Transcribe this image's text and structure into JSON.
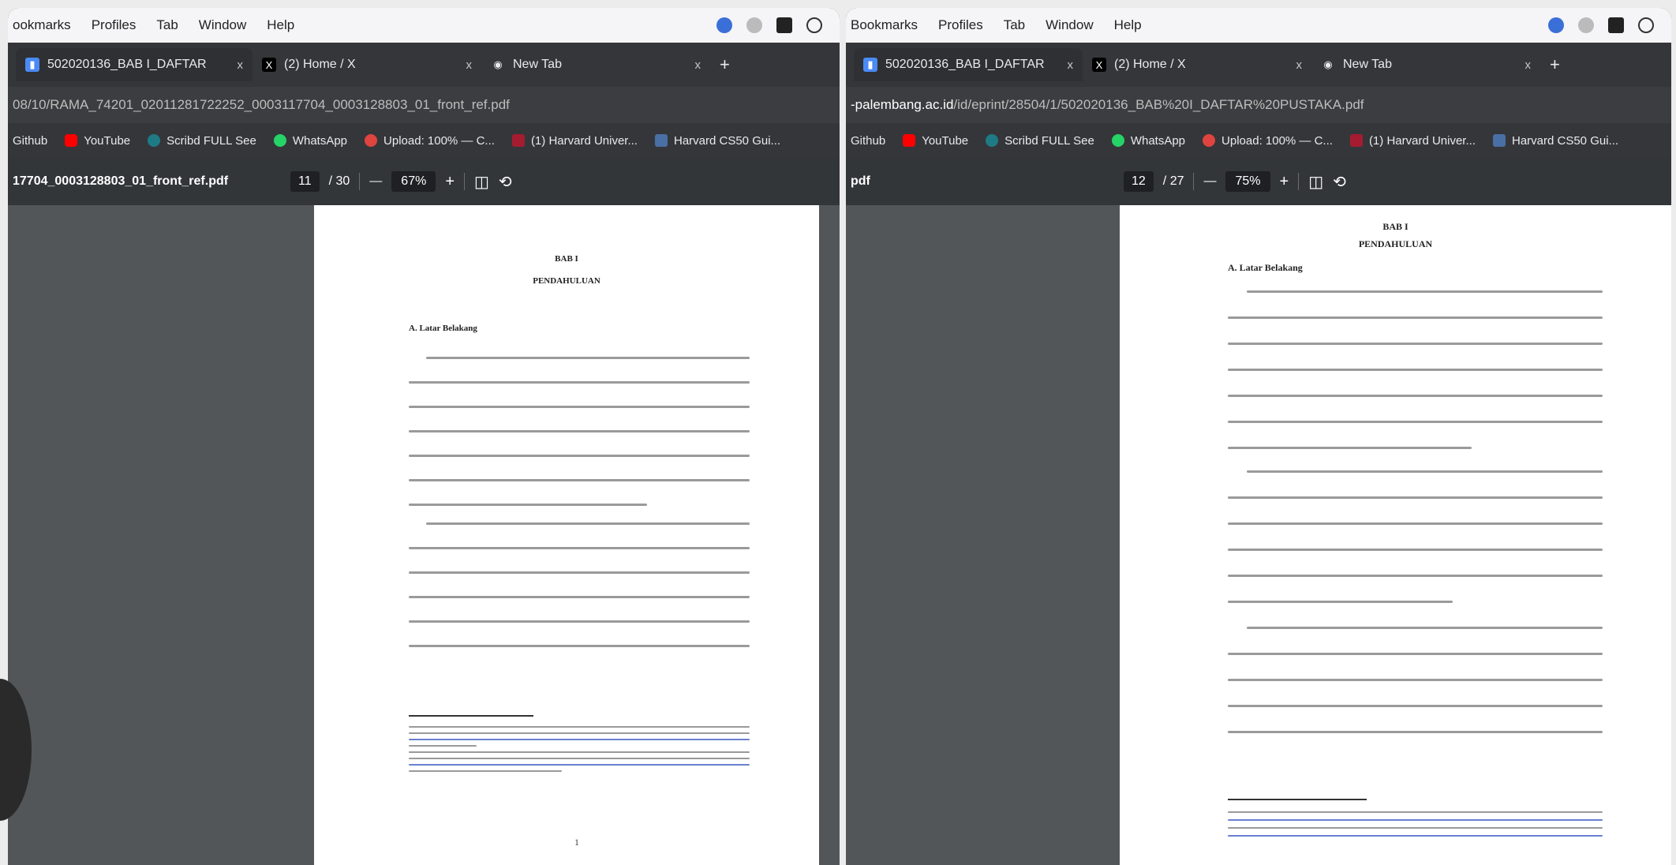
{
  "menu": {
    "items": [
      "Bookmarks",
      "Profiles",
      "Tab",
      "Window",
      "Help"
    ],
    "left_first": "ookmarks"
  },
  "tabs": [
    {
      "label": "502020136_BAB I_DAFTAR"
    },
    {
      "label": "(2) Home / X"
    },
    {
      "label": "New Tab"
    }
  ],
  "left": {
    "url": "08/10/RAMA_74201_02011281722252_0003117704_0003128803_01_front_ref.pdf",
    "pdf_filename": "17704_0003128803_01_front_ref.pdf",
    "page_current": "11",
    "page_total": "/ 30",
    "zoom": "67%",
    "page_number": "1",
    "bab": "BAB I",
    "title": "PENDAHULUAN",
    "section": "A. Latar Belakang"
  },
  "right": {
    "url_host": "-palembang.ac.id",
    "url_path": "/id/eprint/28504/1/502020136_BAB%20I_DAFTAR%20PUSTAKA.pdf",
    "pdf_filename": "pdf",
    "page_current": "12",
    "page_total": "/ 27",
    "zoom": "75%",
    "bab": "BAB I",
    "title": "PENDAHULUAN",
    "section": "A. Latar Belakang"
  },
  "bookmarks": [
    {
      "label": "Github",
      "color": "#ffffff"
    },
    {
      "label": "YouTube",
      "color": "#ff0000"
    },
    {
      "label": "Scribd FULL See",
      "color": "#1e7b85"
    },
    {
      "label": "WhatsApp",
      "color": "#25d366"
    },
    {
      "label": "Upload: 100% — C...",
      "color": "#e0443e"
    },
    {
      "label": "(1) Harvard Univer...",
      "color": "#a51c30"
    },
    {
      "label": "Harvard CS50 Gui...",
      "color": "#4a6fa5"
    }
  ],
  "controls": {
    "minus": "—",
    "plus": "+",
    "close": "x",
    "newtab": "+"
  }
}
